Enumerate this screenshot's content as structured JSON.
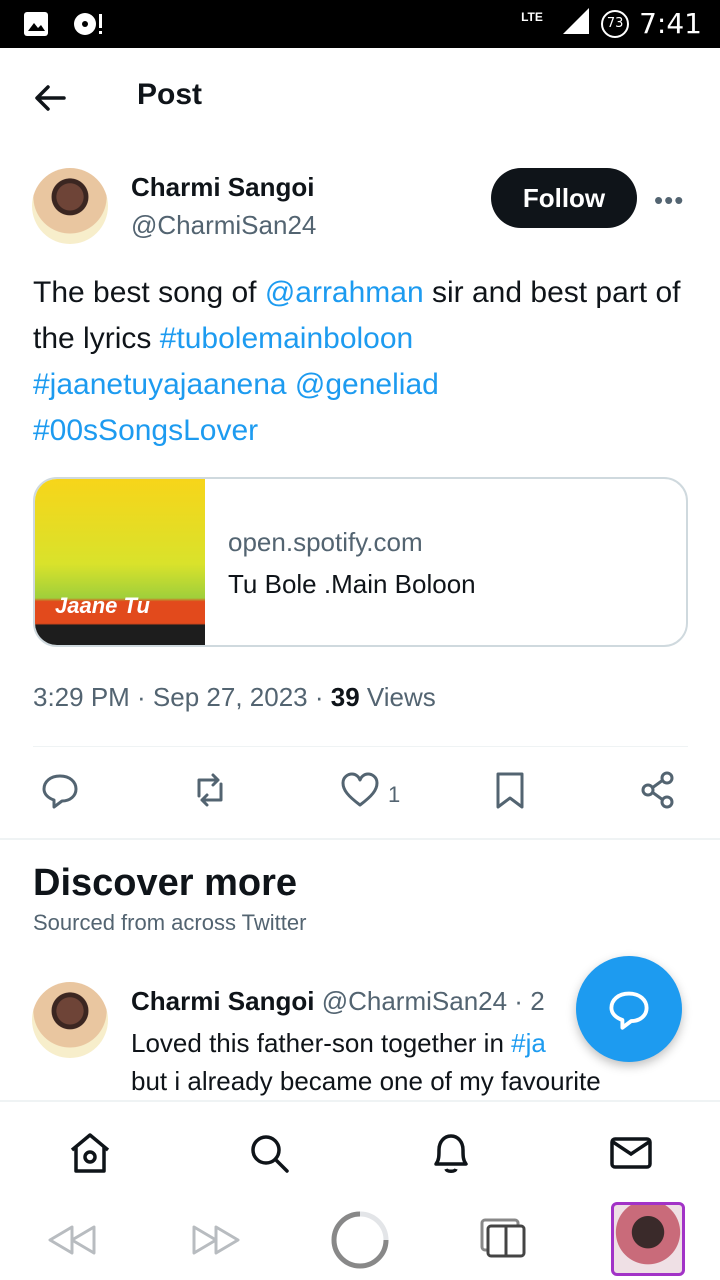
{
  "status": {
    "time": "7:41",
    "network": "LTE",
    "battery": "73"
  },
  "header": {
    "title": "Post"
  },
  "post": {
    "author_name": "Charmi Sangoi",
    "author_handle": "@CharmiSan24",
    "follow_label": "Follow",
    "text": {
      "part1": "The best song of ",
      "mention1": "@arrahman",
      "part2": " sir and best part of the lyrics ",
      "tag1": "#tubolemainboloon",
      "tag2": "#jaanetuyajaanena",
      "mention2": "@geneliad",
      "tag3": "#00sSongsLover"
    },
    "card": {
      "domain": "open.spotify.com",
      "title": "Tu Bole .Main Boloon",
      "thumb_text": "Jaane Tu"
    },
    "timestamp": "3:29 PM · Sep 27, 2023 · ",
    "views_count": "39",
    "views_label": " Views",
    "like_count": "1"
  },
  "discover": {
    "title": "Discover more",
    "subtitle": "Sourced from across Twitter",
    "item": {
      "name": "Charmi Sangoi",
      "handle_time": "@CharmiSan24 · 2",
      "text1": "Loved this father-son together in ",
      "text1_link": "#ja",
      "text2": "but i already became one of my favourite"
    }
  },
  "colors": {
    "accent": "#1d9bf0",
    "text": "#0f1419",
    "secondary": "#536471"
  }
}
